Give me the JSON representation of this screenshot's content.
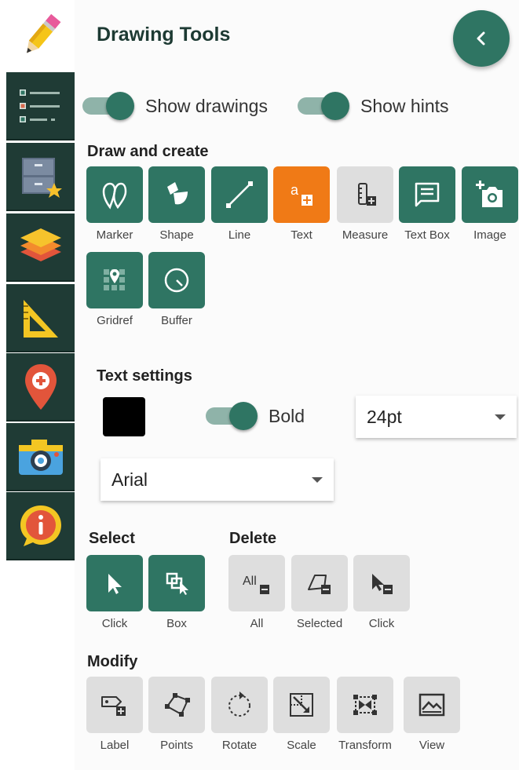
{
  "title": "Drawing Tools",
  "toggles": {
    "show_drawings": "Show drawings",
    "show_hints": "Show hints"
  },
  "sections": {
    "draw_create": "Draw and create",
    "text_settings": "Text settings",
    "select": "Select",
    "delete": "Delete",
    "modify": "Modify"
  },
  "draw_tools": [
    {
      "label": "Marker",
      "icon": "marker-icon"
    },
    {
      "label": "Shape",
      "icon": "shape-icon"
    },
    {
      "label": "Line",
      "icon": "line-icon"
    },
    {
      "label": "Text",
      "icon": "text-add-icon",
      "selected": true
    },
    {
      "label": "Measure",
      "icon": "measure-icon",
      "disabled": true
    },
    {
      "label": "Text Box",
      "icon": "text-box-icon"
    },
    {
      "label": "Image",
      "icon": "add-photo-icon"
    },
    {
      "label": "Gridref",
      "icon": "gridref-icon"
    },
    {
      "label": "Buffer",
      "icon": "buffer-icon"
    }
  ],
  "text_settings": {
    "color": "#000000",
    "bold_label": "Bold",
    "size": "24pt",
    "font": "Arial"
  },
  "select_tools": [
    {
      "label": "Click"
    },
    {
      "label": "Box"
    }
  ],
  "delete_tools": [
    {
      "label": "All",
      "icon_text": "All"
    },
    {
      "label": "Selected"
    },
    {
      "label": "Click"
    }
  ],
  "modify_tools": [
    {
      "label": "Label"
    },
    {
      "label": "Points"
    },
    {
      "label": "Rotate"
    },
    {
      "label": "Scale"
    },
    {
      "label": "Transform"
    },
    {
      "label": "View"
    }
  ],
  "colors": {
    "accent": "#2f7563",
    "sidebar": "#1f3b35",
    "selected": "#f07a16",
    "disabled": "#dedede"
  }
}
